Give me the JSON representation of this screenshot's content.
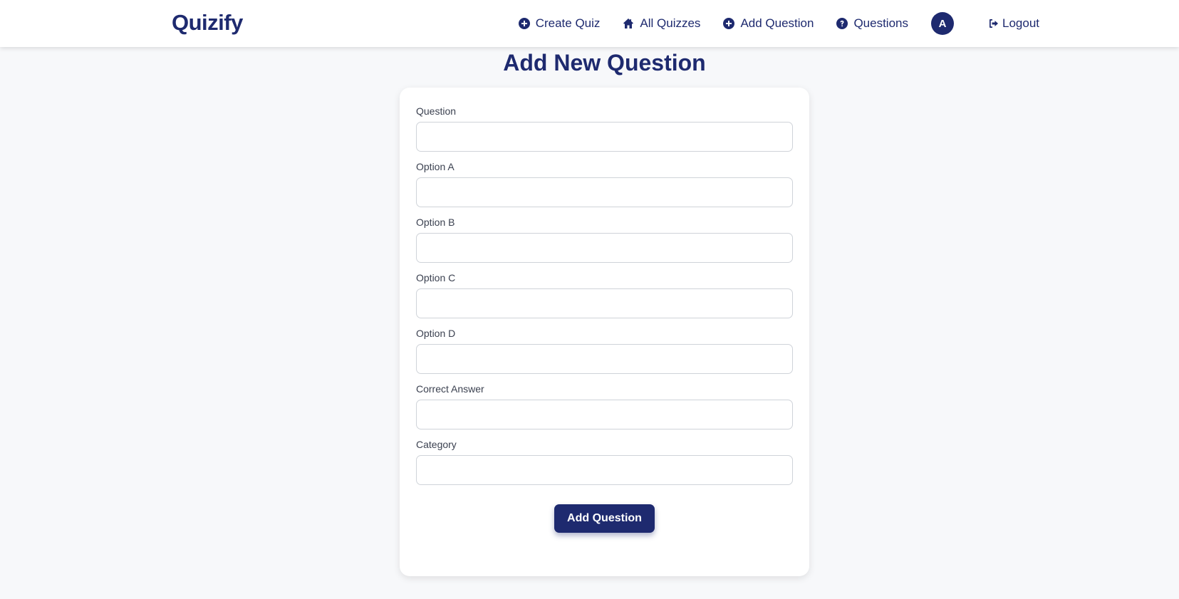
{
  "brand": {
    "name": "Quizify"
  },
  "nav": {
    "items": [
      {
        "label": "Create Quiz",
        "icon": "plus-circle-icon"
      },
      {
        "label": "All Quizzes",
        "icon": "home-icon"
      },
      {
        "label": "Add Question",
        "icon": "plus-circle-icon"
      },
      {
        "label": "Questions",
        "icon": "question-circle-icon"
      }
    ],
    "avatar_initial": "A",
    "logout_label": "Logout",
    "logout_icon": "logout-icon"
  },
  "page": {
    "title": "Add New Question"
  },
  "form": {
    "fields": [
      {
        "label": "Question",
        "value": ""
      },
      {
        "label": "Option A",
        "value": ""
      },
      {
        "label": "Option B",
        "value": ""
      },
      {
        "label": "Option C",
        "value": ""
      },
      {
        "label": "Option D",
        "value": ""
      },
      {
        "label": "Correct Answer",
        "value": ""
      },
      {
        "label": "Category",
        "value": ""
      }
    ],
    "submit_label": "Add Question"
  },
  "colors": {
    "primary": "#1e2a6f",
    "background": "#f7f8fa",
    "card": "#ffffff"
  }
}
